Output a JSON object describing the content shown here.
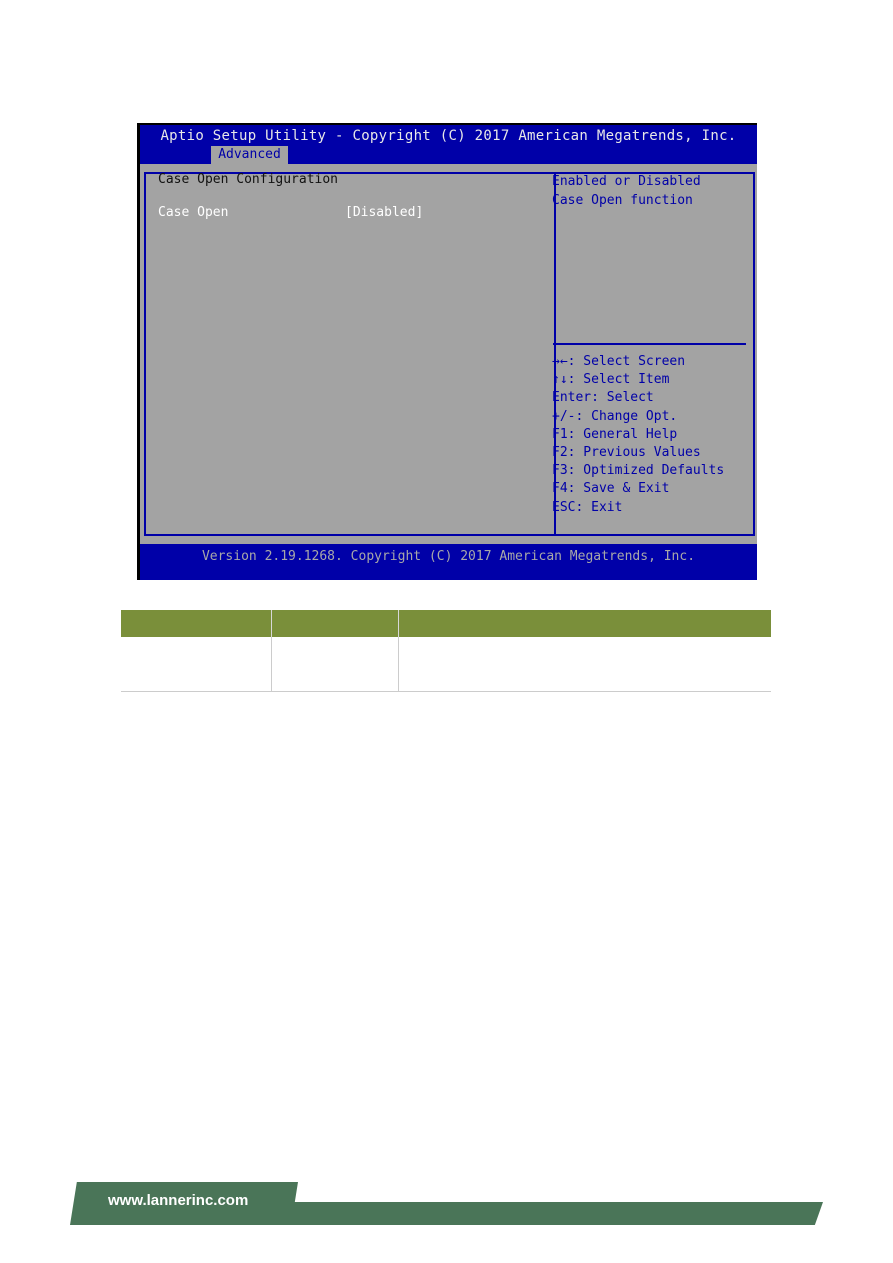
{
  "bios": {
    "title": "Aptio Setup Utility - Copyright (C) 2017 American Megatrends, Inc.",
    "active_tab": "Advanced",
    "section_title": "Case Open Configuration",
    "settings": [
      {
        "label": "Case Open",
        "value": "[Disabled]"
      }
    ],
    "help_text": [
      "Enabled or Disabled",
      "Case Open function"
    ],
    "key_help": [
      "→←: Select Screen",
      "↑↓: Select Item",
      "Enter: Select",
      "+/-: Change Opt.",
      "F1: General Help",
      "F2: Previous Values",
      "F3: Optimized Defaults",
      "F4: Save & Exit",
      "ESC: Exit"
    ],
    "footer": "Version 2.19.1268. Copyright (C) 2017 American Megatrends, Inc.",
    "colors": {
      "background_blue": "#0000a8",
      "panel_gray": "#a3a3a3",
      "highlight_white": "#ffffff"
    }
  },
  "table": {
    "headers": [
      "",
      "",
      ""
    ],
    "rows": [
      [
        "",
        "",
        ""
      ]
    ],
    "header_color": "#7a8f3a"
  },
  "page_footer": {
    "url": "www.lannerinc.com",
    "color": "#4a7558"
  }
}
